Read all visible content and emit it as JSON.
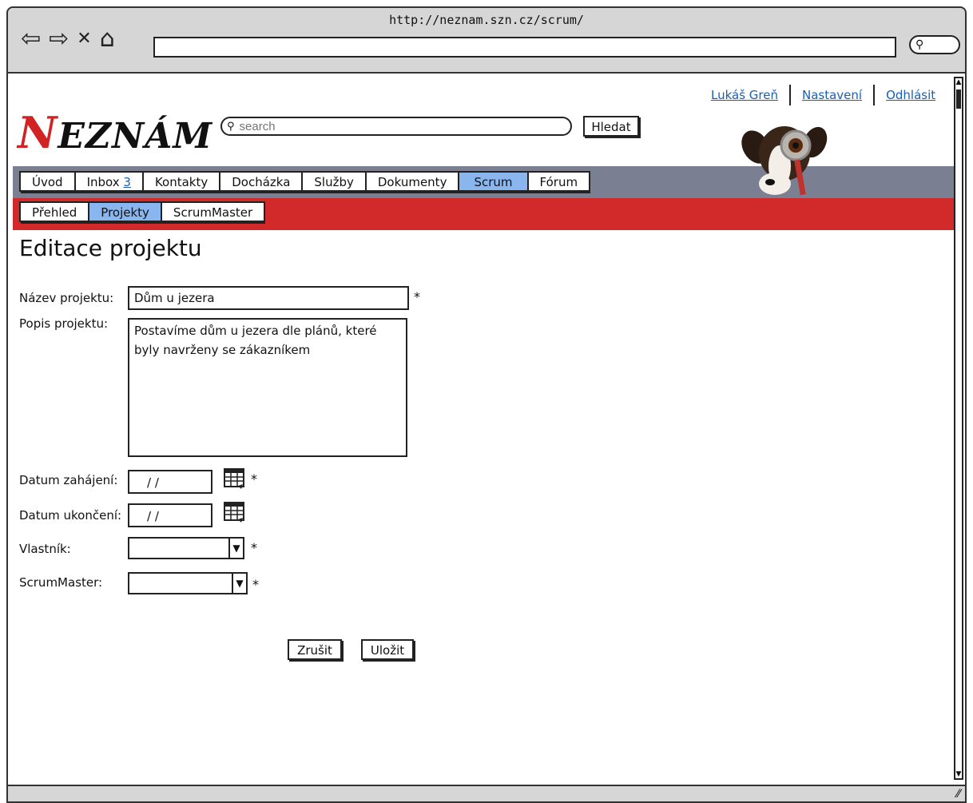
{
  "browser": {
    "url": "http://neznam.szn.cz/scrum/",
    "icons": {
      "back": "back-arrow-icon",
      "forward": "forward-arrow-icon",
      "stop": "close-icon",
      "home": "home-icon",
      "search": "search-icon"
    }
  },
  "header": {
    "logo_initial": "N",
    "logo_rest": "EZNÁM",
    "search_placeholder": "search",
    "search_button": "Hledat",
    "user_links": [
      "Lukáš Greň",
      "Nastavení",
      "Odhlásit"
    ]
  },
  "main_nav": {
    "tabs": [
      {
        "label": "Úvod",
        "active": false
      },
      {
        "label": "Inbox ",
        "count": "3",
        "active": false
      },
      {
        "label": "Kontakty",
        "active": false
      },
      {
        "label": "Docházka",
        "active": false
      },
      {
        "label": "Služby",
        "active": false
      },
      {
        "label": "Dokumenty",
        "active": false
      },
      {
        "label": "Scrum",
        "active": true
      },
      {
        "label": "Fórum",
        "active": false
      }
    ]
  },
  "sub_nav": {
    "tabs": [
      {
        "label": "Přehled",
        "active": false
      },
      {
        "label": "Projekty",
        "active": true
      },
      {
        "label": "ScrumMaster",
        "active": false
      }
    ]
  },
  "form": {
    "title": "Editace projektu",
    "name_label": "Název projektu:",
    "name_value": "Dům u jezera",
    "desc_label": "Popis projektu:",
    "desc_value": "Postavíme dům u jezera dle plánů, které byly navrženy se zákazníkem",
    "start_label": "Datum zahájení:",
    "start_value": "/ /",
    "end_label": "Datum ukončení:",
    "end_value": "/ /",
    "owner_label": "Vlastník:",
    "owner_value": "",
    "scrummaster_label": "ScrumMaster:",
    "scrummaster_value": "",
    "required_mark": "*",
    "cancel_button": "Zrušit",
    "save_button": "Uložit"
  },
  "colors": {
    "nav_bar": "#7a8091",
    "sub_nav_bar": "#d22a2a",
    "active_tab": "#8ab6f0",
    "logo_accent": "#d12323",
    "link": "#1a5fb4"
  }
}
